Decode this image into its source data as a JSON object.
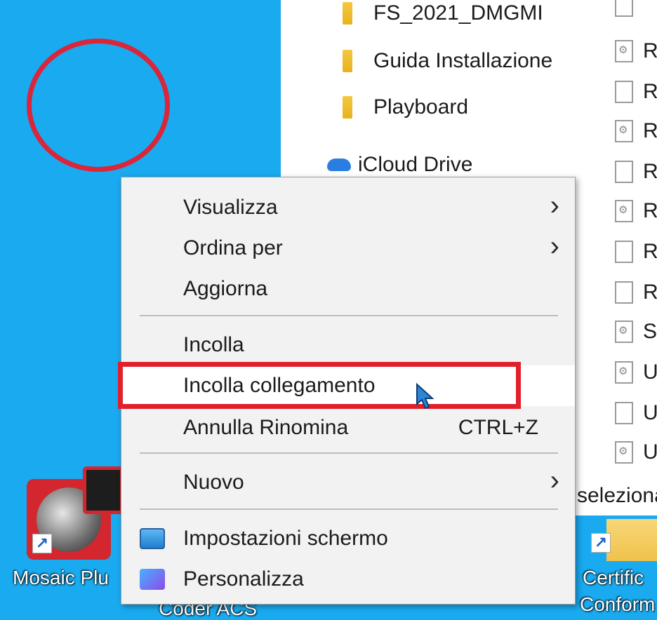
{
  "explorer": {
    "tree": [
      {
        "label": "FS_2021_DMGMI",
        "icon": "folder-icon"
      },
      {
        "label": "Guida Installazione",
        "icon": "folder-icon"
      },
      {
        "label": "Playboard",
        "icon": "folder-icon"
      },
      {
        "label": "iCloud Drive",
        "icon": "cloud-icon"
      }
    ],
    "files": [
      {
        "label": "R",
        "icon": "gear-file-icon"
      },
      {
        "label": "R",
        "icon": "file-icon"
      },
      {
        "label": "R",
        "icon": "gear-file-icon"
      },
      {
        "label": "R",
        "icon": "file-icon"
      },
      {
        "label": "R",
        "icon": "gear-file-icon"
      },
      {
        "label": "R",
        "icon": "file-icon"
      },
      {
        "label": "R",
        "icon": "file-icon"
      },
      {
        "label": "S",
        "icon": "gear-file-icon"
      },
      {
        "label": "U",
        "icon": "gear-file-icon"
      },
      {
        "label": "U",
        "icon": "file-icon"
      },
      {
        "label": "U",
        "icon": "gear-file-icon"
      }
    ],
    "status": "seleziona"
  },
  "desktop": {
    "mosaic_label": "Mosaic Plu",
    "coder_label": "Coder ACS",
    "cert_label_1": "Certific",
    "cert_label_2": "Conform"
  },
  "context_menu": {
    "items": [
      {
        "label": "Visualizza",
        "submenu": true
      },
      {
        "label": "Ordina per",
        "submenu": true
      },
      {
        "label": "Aggiorna"
      },
      {
        "label": "Incolla"
      },
      {
        "label": "Incolla collegamento"
      },
      {
        "label": "Annulla Rinomina",
        "shortcut": "CTRL+Z"
      },
      {
        "label": "Nuovo",
        "submenu": true
      },
      {
        "label": "Impostazioni schermo",
        "icon": "display-settings-icon"
      },
      {
        "label": "Personalizza",
        "icon": "personalize-icon"
      }
    ],
    "chevron": "›"
  },
  "colors": {
    "desktop_bg": "#19aaf0",
    "annotation_red": "#e0202a",
    "menu_bg": "#f2f2f2"
  }
}
